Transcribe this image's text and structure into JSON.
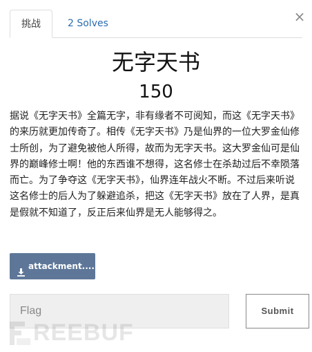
{
  "tabs": {
    "challenge_label": "挑战",
    "solves_label": "2 Solves"
  },
  "close_icon_glyph": "×",
  "challenge": {
    "title": "无字天书",
    "points": "150",
    "description": "据说《无字天书》全篇无字，非有缘者不可阅知，而这《无字天书》的来历就更加传奇了。相传《无字天书》乃是仙界的一位大罗金仙修士所创，为了避免被他人所得，故而为无字天书。这大罗金仙可是仙界的巅峰修士啊！他的东西谁不想得，这名修士在杀劫过后不幸陨落而亡。为了争夺这《无字天书》，仙界连年战火不断。不过后来听说这名修士的后人为了躲避追杀，把这《无字天书》放在了人界，是真是假就不知道了，反正后来仙界是无人能够得之。"
  },
  "attachment": {
    "label": "attackment....",
    "icon": "download-icon"
  },
  "flag_form": {
    "placeholder": "Flag",
    "value": "",
    "submit_label": "Submit"
  },
  "watermark": {
    "text": "REEBUF"
  },
  "colors": {
    "attachment_bg": "#5e7798",
    "link": "#2b6cb0",
    "input_bg": "#efefef"
  }
}
